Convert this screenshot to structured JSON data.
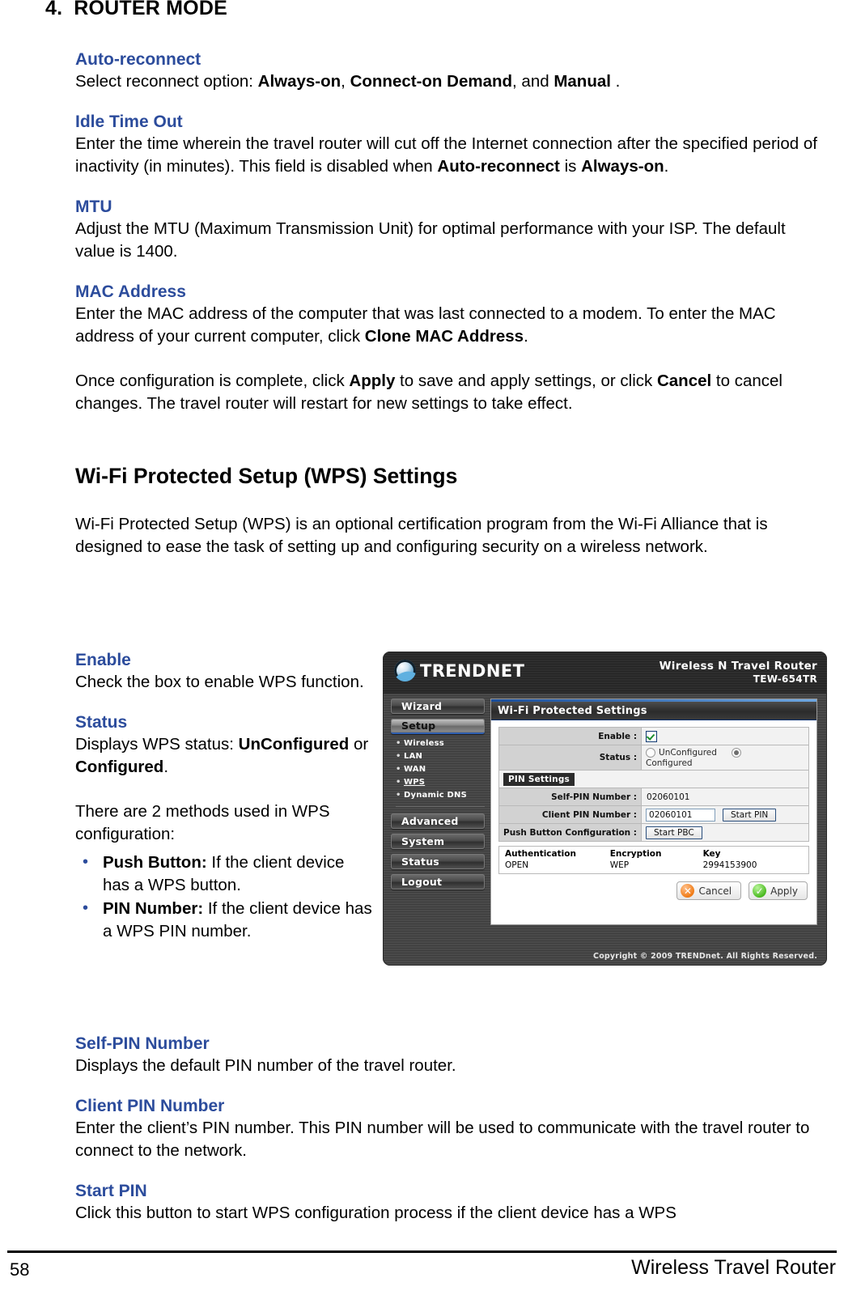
{
  "chapter": {
    "number": "4.",
    "title": "ROUTER MODE"
  },
  "sections": [
    {
      "heading": "Auto-reconnect",
      "paragraph_parts": [
        {
          "text": "Select reconnect option: ",
          "bold": false
        },
        {
          "text": "Always-on",
          "bold": true
        },
        {
          "text": ", ",
          "bold": false
        },
        {
          "text": "Connect-on Demand",
          "bold": true
        },
        {
          "text": ", and ",
          "bold": false
        },
        {
          "text": "Manual",
          "bold": true
        },
        {
          "text": " .",
          "bold": false
        }
      ]
    },
    {
      "heading": "Idle Time Out",
      "paragraph_parts": [
        {
          "text": "Enter the time wherein the travel router will cut off the Internet connection after the specified period of inactivity (in minutes). This field is disabled when ",
          "bold": false
        },
        {
          "text": "Auto-reconnect",
          "bold": true
        },
        {
          "text": " is ",
          "bold": false
        },
        {
          "text": "Always-on",
          "bold": true
        },
        {
          "text": ".",
          "bold": false
        }
      ]
    },
    {
      "heading": "MTU",
      "paragraph_parts": [
        {
          "text": "Adjust the MTU (Maximum Transmission Unit) for optimal performance with your ISP. The default value is 1400.",
          "bold": false
        }
      ]
    },
    {
      "heading": "MAC Address",
      "paragraph_parts": [
        {
          "text": "Enter the MAC address of the computer that was last connected to a modem. To enter the MAC address of your current computer, click ",
          "bold": false
        },
        {
          "text": "Clone MAC Address",
          "bold": true
        },
        {
          "text": ".",
          "bold": false
        }
      ]
    }
  ],
  "apply_paragraph_parts": [
    {
      "text": "Once configuration is complete, click ",
      "bold": false
    },
    {
      "text": "Apply",
      "bold": true
    },
    {
      "text": " to save and apply settings, or click ",
      "bold": false
    },
    {
      "text": "Cancel",
      "bold": true
    },
    {
      "text": " to cancel changes. The travel router will restart for new settings to take effect.",
      "bold": false
    }
  ],
  "wps": {
    "title": "Wi-Fi Protected Setup (WPS) Settings",
    "intro": "Wi-Fi Protected Setup (WPS) is an optional certification program from the Wi-Fi Alliance that is designed to ease the task of setting up and configuring security on a wireless network.",
    "enable": {
      "heading": "Enable",
      "text": "Check the box to enable WPS function."
    },
    "status": {
      "heading": "Status",
      "parts": [
        {
          "text": "Displays WPS status: ",
          "bold": false
        },
        {
          "text": "UnConfigured",
          "bold": true
        },
        {
          "text": " or ",
          "bold": false
        },
        {
          "text": "Configured",
          "bold": true
        },
        {
          "text": ".",
          "bold": false
        }
      ]
    },
    "methods_intro": "There are 2 methods used in WPS configuration:",
    "methods": [
      {
        "term": "Push Button:",
        "desc": " If the client device has a WPS button."
      },
      {
        "term": "PIN Number:",
        "desc": " If the client device has a WPS PIN number."
      }
    ],
    "self_pin": {
      "heading": "Self-PIN Number",
      "text": "Displays the default PIN number of the travel router."
    },
    "client_pin": {
      "heading": "Client PIN Number",
      "text": "Enter the client’s PIN number. This PIN number will be used to communicate with the travel router to connect to the network."
    },
    "start_pin": {
      "heading": "Start PIN",
      "text": "Click this button to start WPS configuration process if the client device has a WPS"
    }
  },
  "screenshot": {
    "brand": "TRENDNET",
    "brand_icon": "trendnet-globe-icon",
    "product_name": "Wireless N Travel Router",
    "model": "TEW-654TR",
    "nav": [
      {
        "label": "Wizard",
        "active": false
      },
      {
        "label": "Setup",
        "active": true
      },
      {
        "label": "Advanced",
        "active": false
      },
      {
        "label": "System",
        "active": false
      },
      {
        "label": "Status",
        "active": false
      },
      {
        "label": "Logout",
        "active": false
      }
    ],
    "subnav": [
      {
        "label": "Wireless",
        "current": false
      },
      {
        "label": "LAN",
        "current": false
      },
      {
        "label": "WAN",
        "current": false
      },
      {
        "label": "WPS",
        "current": true
      },
      {
        "label": "Dynamic DNS",
        "current": false
      }
    ],
    "panel_title": "Wi-Fi Protected Settings",
    "form": {
      "enable_label": "Enable :",
      "enable_checked": true,
      "status_label": "Status :",
      "status_options": [
        {
          "label": "UnConfigured",
          "selected": false
        },
        {
          "label": "Configured",
          "selected": true
        }
      ],
      "pin_section_label": "PIN Settings",
      "self_pin_label": "Self-PIN Number :",
      "self_pin_value": "02060101",
      "client_pin_label": "Client PIN Number :",
      "client_pin_value": "02060101",
      "start_pin_button": "Start PIN",
      "push_button_label": "Push Button Configuration :",
      "start_pbc_button": "Start PBC"
    },
    "key_table": {
      "headers": [
        "Authentication",
        "Encryption",
        "Key"
      ],
      "row": [
        "OPEN",
        "WEP",
        "2994153900"
      ]
    },
    "buttons": {
      "cancel": "Cancel",
      "apply": "Apply",
      "cancel_icon": "x-circle-icon",
      "apply_icon": "check-circle-icon"
    },
    "copyright": "Copyright © 2009 TRENDnet. All Rights Reserved."
  },
  "footer": {
    "page_number": "58",
    "right_text": "Wireless Travel Router"
  },
  "colors": {
    "heading_blue": "#2c4c9c",
    "bullet_blue": "#2c4c9c",
    "cancel_orange": "#f07c17",
    "apply_green": "#4cbb22"
  }
}
